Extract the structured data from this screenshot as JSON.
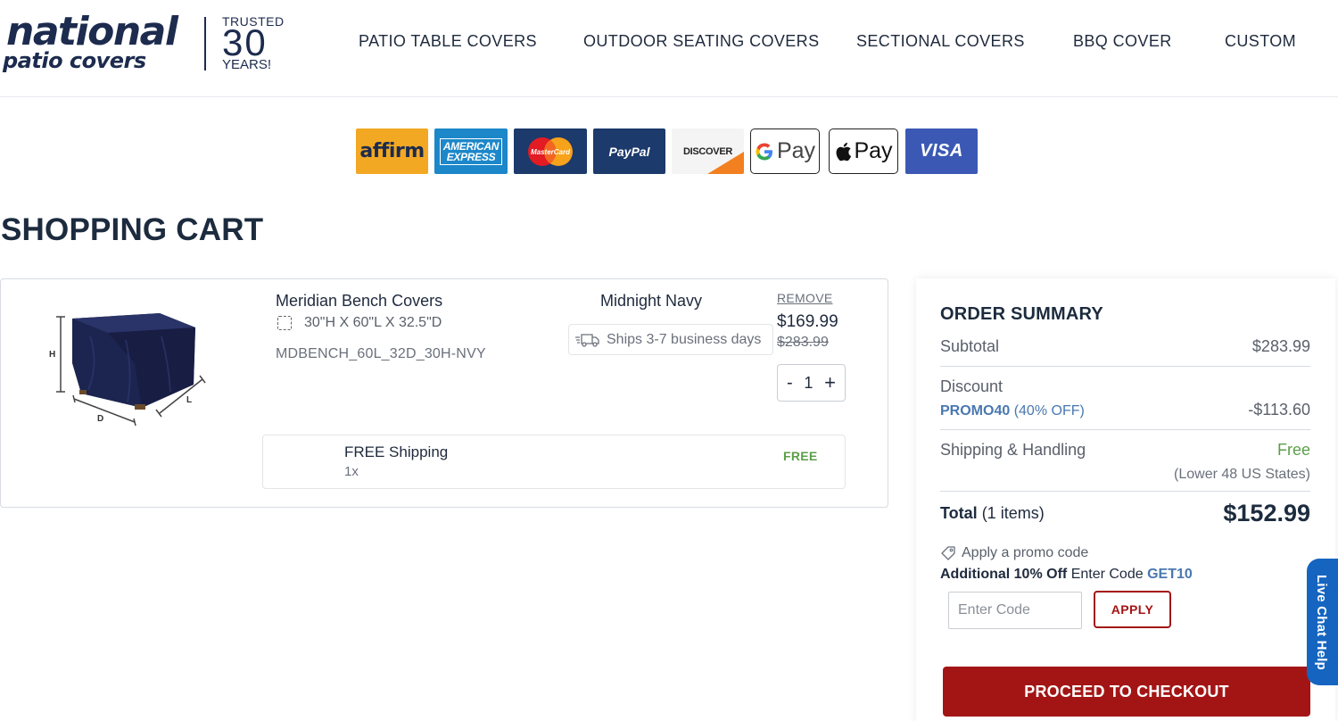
{
  "brand": {
    "logo_main": "national",
    "logo_sub": "patio covers",
    "trusted_line1": "TRUSTED",
    "trusted_number": "30",
    "trusted_line3": "YEARS!"
  },
  "nav": {
    "items": [
      {
        "label": "PATIO TABLE COVERS"
      },
      {
        "label": "OUTDOOR SEATING COVERS"
      },
      {
        "label": "SECTIONAL COVERS"
      },
      {
        "label": "BBQ COVER"
      },
      {
        "label": "CUSTOM"
      }
    ]
  },
  "payments": {
    "affirm": "affirm",
    "amex_line1": "AMERICAN",
    "amex_line2": "EXPRESS",
    "mastercard": "MasterCard",
    "paypal": "PayPal",
    "discover": "DISCOVER",
    "gpay": "Pay",
    "apay": "Pay",
    "visa": "VISA"
  },
  "page": {
    "title": "SHOPPING CART"
  },
  "cart": {
    "item": {
      "name": "Meridian Bench Covers",
      "dimensions": "30\"H X 60\"L X 32.5\"D",
      "sku": "MDBENCH_60L_32D_30H-NVY",
      "color": "Midnight Navy",
      "shipping_time": "Ships 3-7 business days",
      "remove_label": "REMOVE",
      "price": "$169.99",
      "original_price": "$283.99",
      "quantity": "1",
      "minus": "-",
      "plus": "+",
      "image_labels": {
        "h": "H",
        "d": "D",
        "l": "L"
      }
    },
    "shipping_line": {
      "label": "FREE Shipping",
      "qty": "1x",
      "price": "FREE"
    }
  },
  "summary": {
    "title": "ORDER SUMMARY",
    "subtotal_label": "Subtotal",
    "subtotal_value": "$283.99",
    "discount_label": "Discount",
    "promo_code": "PROMO40",
    "promo_pct": "(40% OFF)",
    "discount_value": "-$113.60",
    "shipping_label": "Shipping & Handling",
    "shipping_value": "Free",
    "shipping_note": "(Lower 48 US States)",
    "total_label": "Total",
    "total_items": "(1 items)",
    "total_value": "$152.99",
    "apply_promo_link": "Apply a promo code",
    "offer_bold": "Additional 10% Off",
    "offer_text": "Enter Code",
    "offer_code": "GET10",
    "code_placeholder": "Enter Code",
    "apply_label": "APPLY",
    "checkout_label": "PROCEED TO CHECKOUT"
  },
  "live_chat": {
    "label": "Live Chat Help"
  },
  "colors": {
    "brand_navy": "#1c2b4e",
    "checkout_red": "#a31515",
    "free_green": "#5c9e4a",
    "promo_blue": "#4a78b0",
    "chat_blue": "#1565c0"
  }
}
